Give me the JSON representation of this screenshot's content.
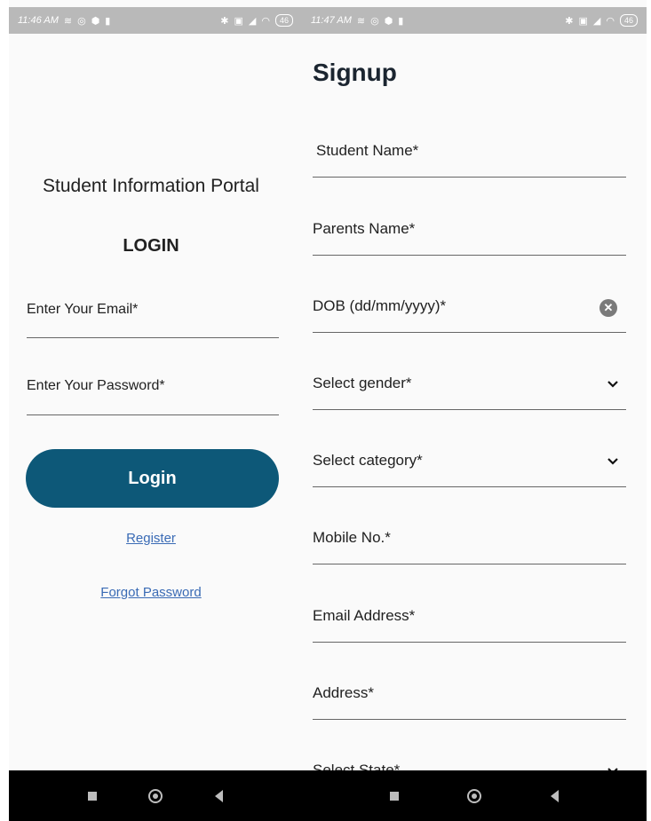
{
  "left": {
    "status": {
      "time": "11:46 AM",
      "battery": "46"
    },
    "portal_title": "Student Information Portal",
    "login_heading": "LOGIN",
    "email_placeholder": "Enter Your Email*",
    "password_placeholder": "Enter Your Password*",
    "login_button": "Login",
    "register_link": "Register",
    "forgot_link": "Forgot Password"
  },
  "right": {
    "status": {
      "time": "11:47 AM",
      "battery": "46"
    },
    "title": "Signup",
    "fields": [
      {
        "label": "Student Name*"
      },
      {
        "label": "Parents Name*"
      },
      {
        "label": "DOB (dd/mm/yyyy)*",
        "icon": "clear-icon"
      },
      {
        "label": "Select gender*",
        "icon": "chevron-down-icon"
      },
      {
        "label": "Select category*",
        "icon": "chevron-down-icon"
      },
      {
        "label": "Mobile No.*"
      },
      {
        "label": "Email Address*"
      },
      {
        "label": "Address*"
      },
      {
        "label": "Select State*",
        "icon": "chevron-down-icon"
      }
    ]
  },
  "colors": {
    "primary": "#0d5878",
    "link": "#3a6bb5",
    "statusbar": "#b9b9b9",
    "navbar": "#000000"
  }
}
